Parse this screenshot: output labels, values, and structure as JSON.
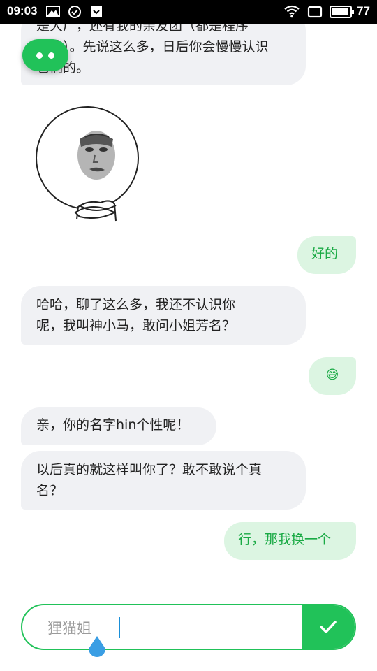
{
  "status_bar": {
    "time": "09:03",
    "left_icons": [
      "image-icon",
      "check-circle-icon",
      "shield-heart-icon"
    ],
    "right_icons": [
      "wifi-icon",
      "screen-icon",
      "battery-icon"
    ],
    "battery": "77"
  },
  "float_button": {
    "icon": "chat-dots-icon"
  },
  "messages": [
    {
      "side": "left",
      "line1": "是大厂，还有我的亲友团（都是程序",
      "line2": "猿的）。先说这么多，日后你会慢慢认识",
      "line3": "它们的。"
    },
    {
      "side": "left",
      "type": "sticker",
      "sticker": "meme-face-sticker"
    },
    {
      "side": "right",
      "text": "好的"
    },
    {
      "side": "left",
      "line1": "哈哈，聊了这么多，我还不认识你",
      "line2": "呢，我叫神小马，敢问小姐芳名？"
    },
    {
      "side": "right",
      "emoji": "😅"
    },
    {
      "side": "left",
      "text": "亲，你的名字hin个性呢！"
    },
    {
      "side": "left",
      "line1": "以后真的就这样叫你了？敢不敢说个真",
      "line2": "名？"
    },
    {
      "side": "right",
      "text": "行，那我换一个"
    }
  ],
  "composer": {
    "value": "狸猫姐",
    "send_icon": "checkmark-icon",
    "accent": "#21c259"
  }
}
